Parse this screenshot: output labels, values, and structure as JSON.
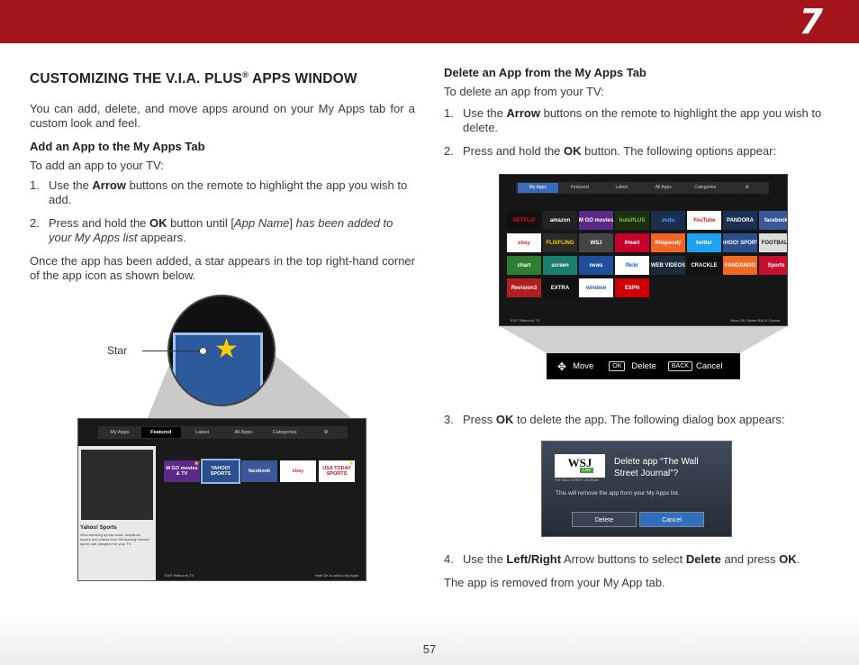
{
  "header": {
    "chapter": "7"
  },
  "left": {
    "title": "CUSTOMIZING THE V.I.A. PLUS",
    "title_reg": "®",
    "title_tail": " APPS WINDOW",
    "intro": "You can add, delete, and move apps around on your My Apps tab for a custom look and feel.",
    "add_heading": "Add an App to the My Apps Tab",
    "add_lead": "To add an app to your TV:",
    "step1_num": "1.",
    "step1_a": "Use the ",
    "step1_b": "Arrow",
    "step1_c": " buttons on the remote to highlight the app you wish to add.",
    "step2_num": "2.",
    "step2_a": "Press and hold the ",
    "step2_b": "OK",
    "step2_c": " button until [",
    "step2_d": "App Name",
    "step2_e": "] ",
    "step2_f": "has been added to your My Apps list",
    "step2_g": " appears.",
    "after": "Once the app has been added, a star appears in the top right-hand corner of the app icon as shown below.",
    "star_label": "Star"
  },
  "tv1": {
    "tabs": [
      "My Apps",
      "Featured",
      "Latest",
      "All Apps",
      "Categories",
      "⚙"
    ],
    "side_title": "Yahoo! Sports",
    "side_text": "View breaking sports news, headlines, scores and videos from the leading Internet sports site designed for your TV.",
    "apps": [
      {
        "label": "M GO movies & TV",
        "bg": "#5a2a86",
        "fg": "#ffffff",
        "star": true
      },
      {
        "label": "YAHOO! SPORTS",
        "bg": "#2a4f8c",
        "fg": "#ffffff",
        "star": false
      },
      {
        "label": "facebook",
        "bg": "#3b5998",
        "fg": "#ffffff",
        "star": false
      },
      {
        "label": "ebay",
        "bg": "#ffffff",
        "fg": "#e53238",
        "star": false
      },
      {
        "label": "USA TODAY SPORTS",
        "bg": "#ffffff",
        "fg": "#c8102e",
        "star": true
      }
    ],
    "status_left": "EXIT Return to TV",
    "status_right": "Hold OK to add to My Apps"
  },
  "right": {
    "del_heading": "Delete an App from the My Apps Tab",
    "del_lead": "To delete an app from your TV:",
    "step1_num": "1.",
    "step1_a": "Use the ",
    "step1_b": "Arrow",
    "step1_c": " buttons on the remote to highlight the app you wish to delete.",
    "step2_num": "2.",
    "step2_a": "Press and hold the ",
    "step2_b": "OK",
    "step2_c": " button. The following options appear:",
    "step3_num": "3.",
    "step3_a": "Press ",
    "step3_b": "OK",
    "step3_c": " to delete the app. The following dialog box appears:",
    "step4_num": "4.",
    "step4_a": "Use the ",
    "step4_b": "Left/Right",
    "step4_c": " Arrow buttons to select ",
    "step4_d": "Delete",
    "step4_e": " and press ",
    "step4_f": "OK",
    "step4_g": ".",
    "final": "The app is removed from your My App tab."
  },
  "tv2": {
    "tabs": [
      "My Apps",
      "Featured",
      "Latest",
      "All Apps",
      "Categories",
      "⚙"
    ],
    "tiles": [
      {
        "label": "NETFLIX",
        "bg": "#111111",
        "fg": "#e50914"
      },
      {
        "label": "amazon",
        "bg": "#222222",
        "fg": "#ffffff"
      },
      {
        "label": "M GO movies",
        "bg": "#5a2a86",
        "fg": "#ffffff"
      },
      {
        "label": "huluPLUS",
        "bg": "#1c2f12",
        "fg": "#8bc53f"
      },
      {
        "label": "vudu",
        "bg": "#1a2e4e",
        "fg": "#4fa3ff"
      },
      {
        "label": "YouTube",
        "bg": "#ffffff",
        "fg": "#cc181e"
      },
      {
        "label": "PANDORA",
        "bg": "#1b2f56",
        "fg": "#ffffff"
      },
      {
        "label": "facebook",
        "bg": "#3b5998",
        "fg": "#ffffff"
      },
      {
        "label": "ebay",
        "bg": "#ffffff",
        "fg": "#e53238"
      },
      {
        "label": "FLIXFLING",
        "bg": "#2a2a2a",
        "fg": "#ffcc00"
      },
      {
        "label": "WSJ",
        "bg": "#444444",
        "fg": "#ffffff"
      },
      {
        "label": "iHeart",
        "bg": "#c6002b",
        "fg": "#ffffff"
      },
      {
        "label": "Rhapsody",
        "bg": "#f26522",
        "fg": "#ffffff"
      },
      {
        "label": "twitter",
        "bg": "#1da1f2",
        "fg": "#ffffff"
      },
      {
        "label": "YAHOO! SPORTS",
        "bg": "#2a4f8c",
        "fg": "#ffffff"
      },
      {
        "label": "FOOTBALL",
        "bg": "#dddddd",
        "fg": "#222222"
      },
      {
        "label": "chart",
        "bg": "#2e7d32",
        "fg": "#ffffff"
      },
      {
        "label": "screen",
        "bg": "#1b7f6e",
        "fg": "#ffffff"
      },
      {
        "label": "news",
        "bg": "#1f4f9a",
        "fg": "#ffffff"
      },
      {
        "label": "flickr",
        "bg": "#ffffff",
        "fg": "#0063dc"
      },
      {
        "label": "WEB VIDEOS",
        "bg": "#1a2a3a",
        "fg": "#ffffff"
      },
      {
        "label": "CRACKLE",
        "bg": "#111111",
        "fg": "#ffffff"
      },
      {
        "label": "FANDANGO",
        "bg": "#f26a21",
        "fg": "#ffffff"
      },
      {
        "label": "Sports",
        "bg": "#c8102e",
        "fg": "#ffffff"
      },
      {
        "label": "Revision3",
        "bg": "#b01f1f",
        "fg": "#ffffff"
      },
      {
        "label": "EXTRA",
        "bg": "#111111",
        "fg": "#ffffff"
      },
      {
        "label": "window",
        "bg": "#ffffff",
        "fg": "#2255aa"
      },
      {
        "label": "ESPN",
        "bg": "#cc0000",
        "fg": "#ffffff"
      }
    ],
    "status_left": "EXIT Return to TV",
    "status_right": "Move  OK Delete  BACK Cancel"
  },
  "options": {
    "move": "Move",
    "ok_key": "OK",
    "delete": "Delete",
    "back_key": "BACK",
    "cancel": "Cancel"
  },
  "dialog": {
    "logo": "WSJ",
    "live": "Live",
    "logo_sub": "THE WALL STREET JOURNAL",
    "message": "Delete app “The Wall Street Journal”?",
    "note": "This will remove the app from your My Apps list.",
    "delete_btn": "Delete",
    "cancel_btn": "Cancel"
  },
  "footer": {
    "page": "57"
  }
}
